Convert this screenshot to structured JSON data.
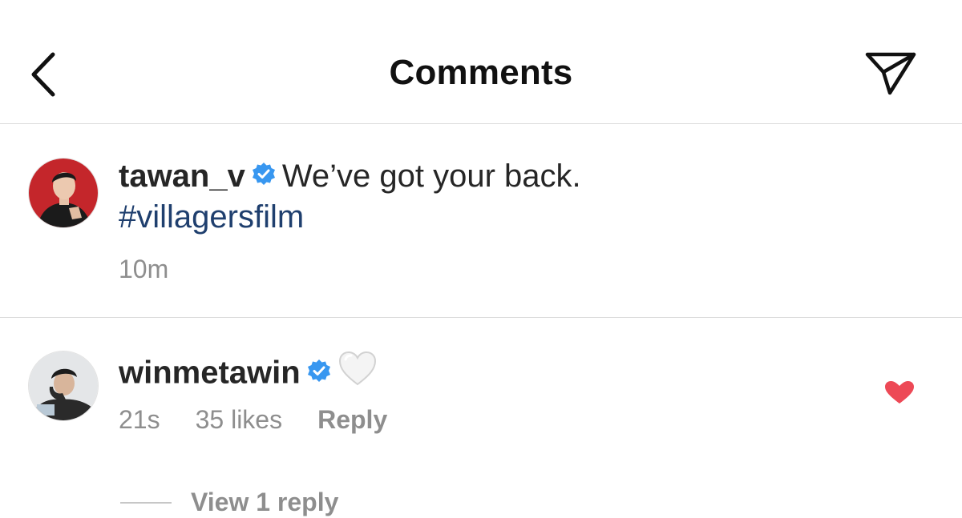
{
  "header": {
    "title": "Comments",
    "back_icon": "chevron-left-icon",
    "share_icon": "paper-plane-icon"
  },
  "caption": {
    "username": "tawan_v",
    "verified": true,
    "text": "We’ve got your back.",
    "hashtag": "#villagersfilm",
    "time": "10m"
  },
  "comment": {
    "username": "winmetawin",
    "verified": true,
    "text_icon": "white-heart-emoji",
    "time": "21s",
    "likes": "35 likes",
    "reply_label": "Reply",
    "liked": true,
    "view_replies_label": "View 1 reply"
  },
  "colors": {
    "verified_blue": "#3897f0",
    "hashtag": "#1f3f6e",
    "like_red": "#ed4956",
    "meta_gray": "#8e8e8e",
    "divider": "#dbdbdb"
  }
}
